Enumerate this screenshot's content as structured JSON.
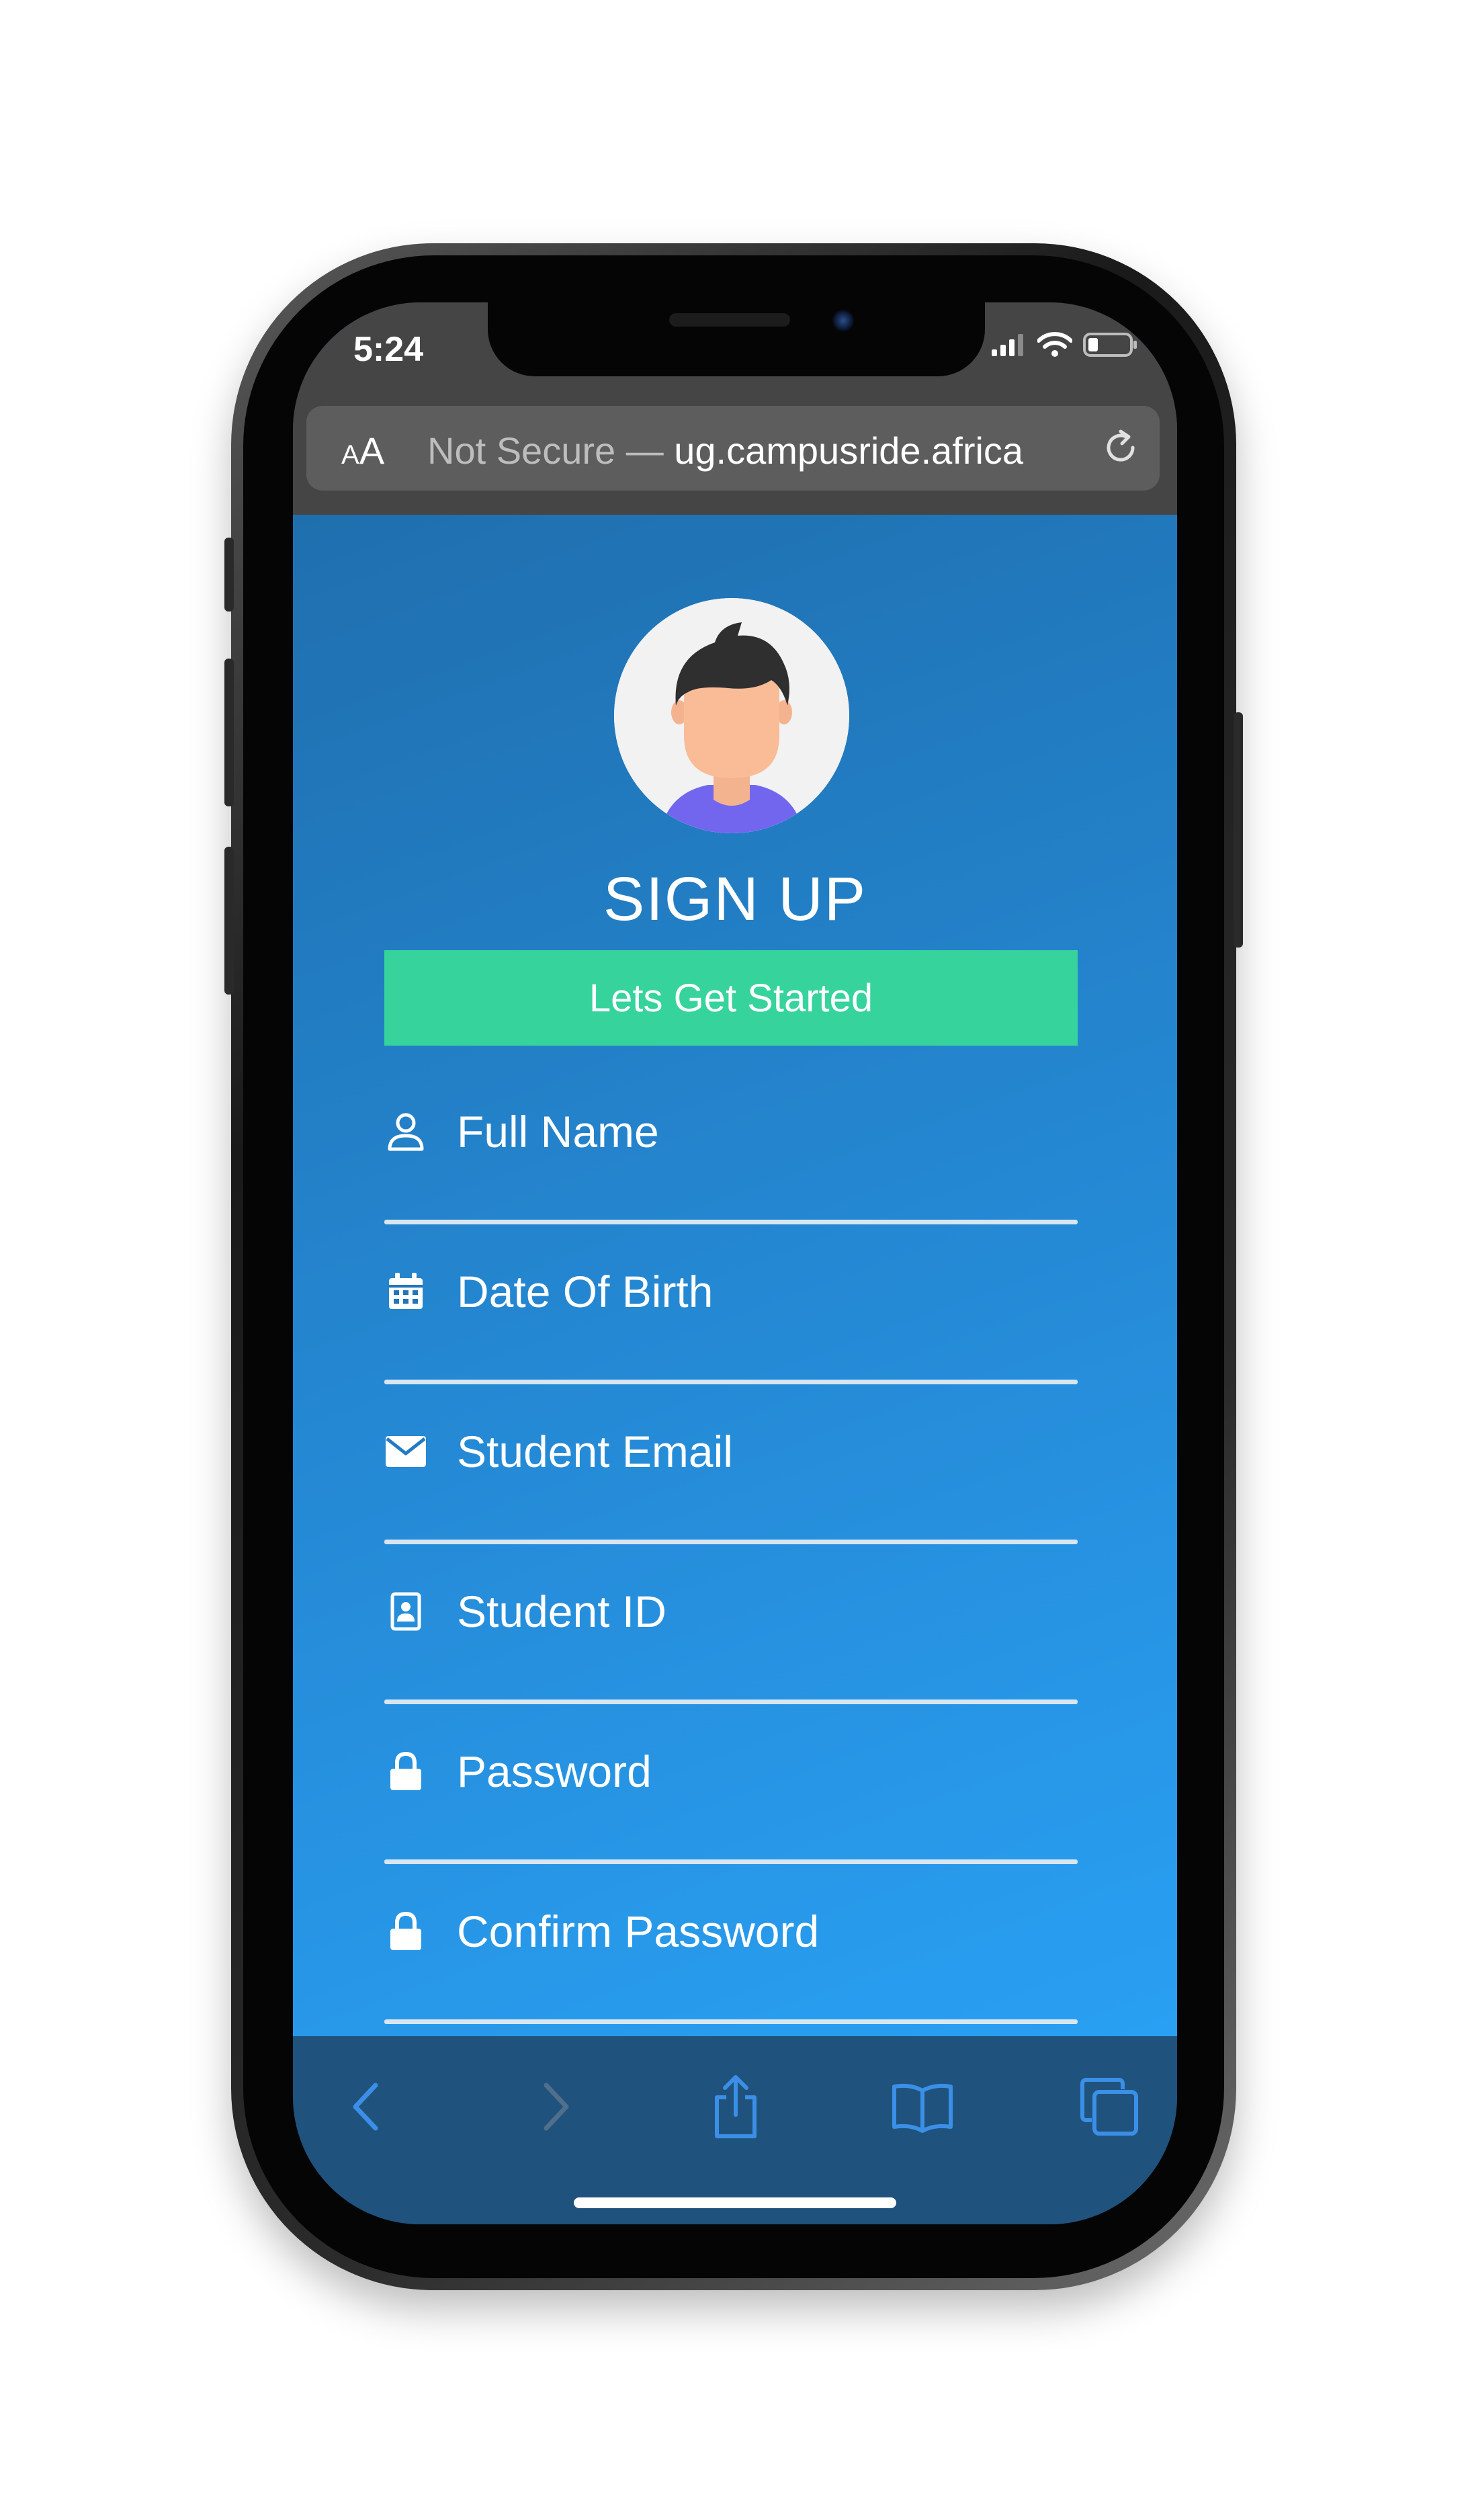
{
  "status_bar": {
    "time": "5:24"
  },
  "browser": {
    "text_size_small": "A",
    "text_size_large": "A",
    "url_security": "Not Secure —",
    "url_domain": " ug.campusride.africa"
  },
  "page": {
    "title": "SIGN UP",
    "cta_label": "Lets Get Started",
    "fields": [
      {
        "placeholder": "Full Name",
        "icon": "user-icon"
      },
      {
        "placeholder": "Date Of Birth",
        "icon": "calendar-icon"
      },
      {
        "placeholder": "Student Email",
        "icon": "envelope-icon"
      },
      {
        "placeholder": "Student ID",
        "icon": "id-card-icon"
      },
      {
        "placeholder": "Password",
        "icon": "lock-icon"
      },
      {
        "placeholder": "Confirm Password",
        "icon": "lock-icon"
      }
    ]
  },
  "toolbar": {
    "icons": [
      "back-icon",
      "forward-icon",
      "share-icon",
      "bookmarks-icon",
      "tabs-icon"
    ]
  },
  "colors": {
    "accent_green": "#37d39d",
    "content_blue_top": "#1f6fae",
    "content_blue_bottom": "#29a0f3",
    "toolbar_blue": "#1f527d",
    "toolbar_icon": "#3b8fe6"
  }
}
